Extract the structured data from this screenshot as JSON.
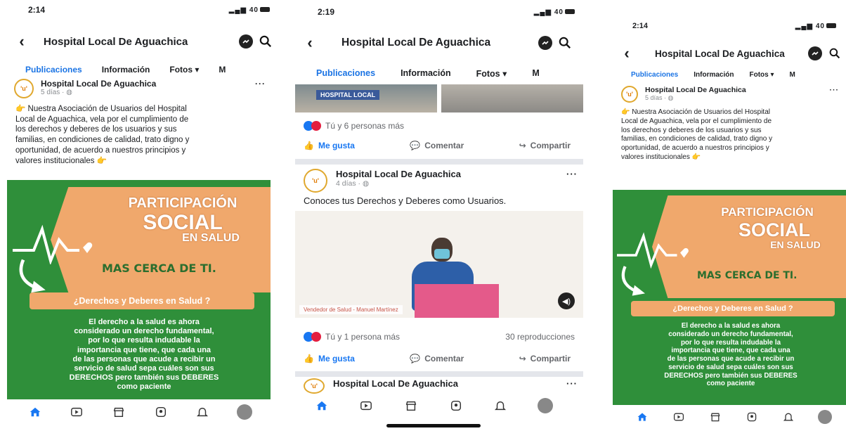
{
  "page_name": "Hospital Local De Aguachica",
  "tabs": [
    "Publicaciones",
    "Información",
    "Fotos ▾",
    "M"
  ],
  "phone1": {
    "time": "2:14",
    "signal": "40"
  },
  "phone2": {
    "time": "2:19",
    "signal": "40"
  },
  "phone3": {
    "time": "2:14",
    "signal": "40"
  },
  "post1": {
    "author": "Hospital Local De Aguachica",
    "time": "5 días · ",
    "text_lines": [
      "👉 Nuestra Asociación de Usuarios del Hospital",
      "Local de Aguachica, vela por el cumplimiento de",
      "los derechos y deberes de los usuarios y sus",
      "familias, en condiciones de calidad, trato digno y",
      "oportunidad, de acuerdo a nuestros principios y",
      "valores institucionales 👉"
    ]
  },
  "poster": {
    "line1": "PARTICIPACIÓN",
    "line2": "SOCIAL",
    "line3": "EN SALUD",
    "mas": "MAS CERCA DE TI.",
    "pill": "¿Derechos y Deberes en Salud ?",
    "para": [
      "El derecho a la salud es ahora",
      "considerado un derecho fundamental,",
      "por lo que resulta indudable la",
      "importancia que tiene, que cada una",
      "de las personas que acude a recibir un",
      "servicio de salud sepa cuáles son sus",
      "DERECHOS pero también sus DEBERES",
      "como paciente"
    ]
  },
  "phone2_feed": {
    "photo_sign": "HOSPITAL LOCAL",
    "reactions1": "Tú y 6 personas más",
    "like": "Me gusta",
    "comment": "Comentar",
    "share": "Compartir",
    "post2_author": "Hospital Local De Aguachica",
    "post2_time": "4 días · ",
    "post2_text": "Conoces tus Derechos y Deberes como Usuarios.",
    "video_caption": "Vendedor de Salud - Manuel Martínez",
    "reactions2": "Tú y 1 persona más",
    "views": "30 reproducciones",
    "post3_author": "Hospital Local De Aguachica"
  },
  "colors": {
    "accent": "#1b74e4",
    "poster_green": "#2f8f3a",
    "poster_orange": "#f0a86c",
    "like_blue": "#1877f2",
    "love_red": "#e41e3f"
  },
  "icons": [
    "back-icon",
    "messenger-icon",
    "search-icon",
    "home-icon",
    "watch-icon",
    "marketplace-icon",
    "groups-icon",
    "notifications-icon",
    "profile-avatar"
  ]
}
